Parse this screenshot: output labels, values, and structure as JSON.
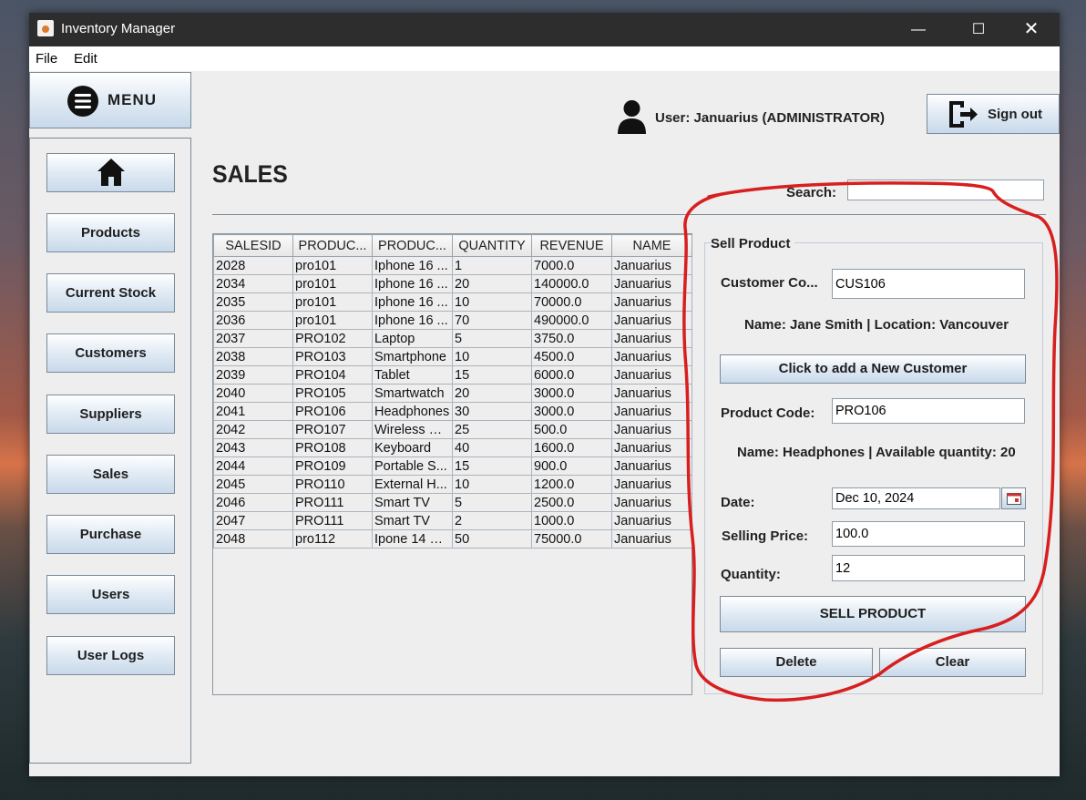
{
  "window": {
    "title": "Inventory Manager"
  },
  "menubar": {
    "file": "File",
    "edit": "Edit"
  },
  "header": {
    "menu_label": "MENU",
    "user_text": "User: Januarius (ADMINISTRATOR)",
    "signout_label": "Sign out"
  },
  "sidebar": {
    "items": [
      "Products",
      "Current Stock",
      "Customers",
      "Suppliers",
      "Sales",
      "Purchase",
      "Users",
      "User Logs"
    ]
  },
  "page": {
    "title": "SALES",
    "search_label": "Search:",
    "search_value": ""
  },
  "table": {
    "columns": [
      "SALESID",
      "PRODUC...",
      "PRODUC...",
      "QUANTITY",
      "REVENUE",
      "NAME"
    ],
    "rows": [
      [
        "2028",
        "pro101",
        "Iphone 16 ...",
        "1",
        "7000.0",
        "Januarius"
      ],
      [
        "2034",
        "pro101",
        "Iphone 16 ...",
        "20",
        "140000.0",
        "Januarius"
      ],
      [
        "2035",
        "pro101",
        "Iphone 16 ...",
        "10",
        "70000.0",
        "Januarius"
      ],
      [
        "2036",
        "pro101",
        "Iphone 16 ...",
        "70",
        "490000.0",
        "Januarius"
      ],
      [
        "2037",
        "PRO102",
        "Laptop",
        "5",
        "3750.0",
        "Januarius"
      ],
      [
        "2038",
        "PRO103",
        "Smartphone",
        "10",
        "4500.0",
        "Januarius"
      ],
      [
        "2039",
        "PRO104",
        "Tablet",
        "15",
        "6000.0",
        "Januarius"
      ],
      [
        "2040",
        "PRO105",
        "Smartwatch",
        "20",
        "3000.0",
        "Januarius"
      ],
      [
        "2041",
        "PRO106",
        "Headphones",
        "30",
        "3000.0",
        "Januarius"
      ],
      [
        "2042",
        "PRO107",
        "Wireless M...",
        "25",
        "500.0",
        "Januarius"
      ],
      [
        "2043",
        "PRO108",
        "Keyboard",
        "40",
        "1600.0",
        "Januarius"
      ],
      [
        "2044",
        "PRO109",
        "Portable S...",
        "15",
        "900.0",
        "Januarius"
      ],
      [
        "2045",
        "PRO110",
        "External H...",
        "10",
        "1200.0",
        "Januarius"
      ],
      [
        "2046",
        "PRO111",
        "Smart TV",
        "5",
        "2500.0",
        "Januarius"
      ],
      [
        "2047",
        "PRO111",
        "Smart TV",
        "2",
        "1000.0",
        "Januarius"
      ],
      [
        "2048",
        "pro112",
        "Ipone 14 Pr...",
        "50",
        "75000.0",
        "Januarius"
      ]
    ]
  },
  "sell": {
    "group_title": "Sell Product",
    "customer_label": "Customer Co...",
    "customer_value": "CUS106",
    "customer_info": "Name: Jane Smith | Location: Vancouver",
    "add_customer_label": "Click to add a New Customer",
    "product_label": "Product Code:",
    "product_value": "PRO106",
    "product_info": "Name: Headphones | Available quantity: 20",
    "date_label": "Date:",
    "date_value": "Dec 10, 2024",
    "price_label": "Selling Price:",
    "price_value": "100.0",
    "qty_label": "Quantity:",
    "qty_value": "12",
    "sell_label": "SELL PRODUCT",
    "delete_label": "Delete",
    "clear_label": "Clear"
  },
  "colors": {
    "annotation": "#d81f1f",
    "titlebar": "#2d2d2d",
    "button_gradient_end": "#c8d9ea"
  },
  "icons": [
    "java-app-icon",
    "minimize-icon",
    "maximize-icon",
    "close-icon",
    "hamburger-menu-icon",
    "user-icon",
    "sign-out-icon",
    "home-icon",
    "calendar-icon"
  ]
}
